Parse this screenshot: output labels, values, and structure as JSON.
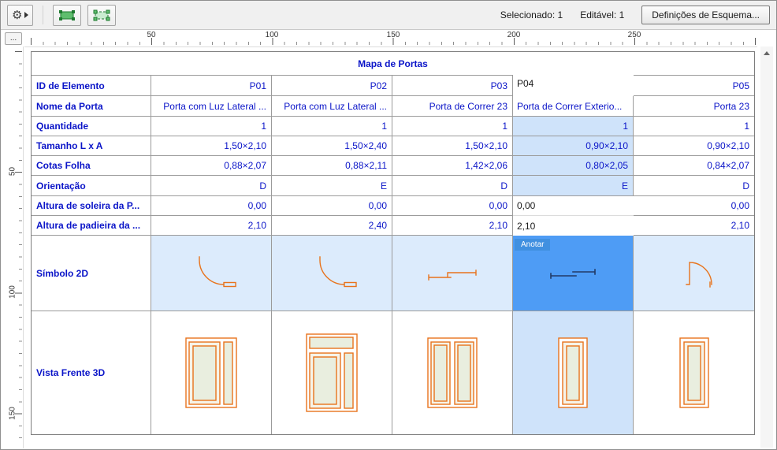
{
  "toolbar": {
    "status_selected": "Selecionado: 1",
    "status_editable": "Editável: 1",
    "scheme_button_label": "Definições de Esquema...",
    "icons": {
      "settings": "gear-with-dropdown-arrow",
      "button_1": "green-selection-rectangle",
      "button_2": "green-selection-rectangle-outline"
    }
  },
  "rulers": {
    "corner_button_label": "...",
    "horizontal_labels": [
      "50",
      "100",
      "150",
      "200",
      "250"
    ],
    "vertical_labels": [
      "50",
      "100",
      "150"
    ]
  },
  "schedule": {
    "title": "Mapa de Portas",
    "row_labels": [
      "ID de Elemento",
      "Nome da Porta",
      "Quantidade",
      "Tamanho L x A",
      "Cotas Folha",
      "Orientação",
      "Altura de soleira da P...",
      "Altura de padieira da ...",
      "Símbolo 2D",
      "Vista Frente 3D"
    ],
    "annotate_button_label": "Anotar",
    "doors": [
      {
        "id": "P01",
        "nome": "Porta com Luz Lateral ...",
        "quantidade": "1",
        "tamanho": "1,50×2,10",
        "cotas_folha": "0,88×2,07",
        "orientacao": "D",
        "altura_soleira": "0,00",
        "altura_padieira": "2,10",
        "simbolo_2d": "swing-door",
        "vista_3d": "door-with-sidelight"
      },
      {
        "id": "P02",
        "nome": "Porta com Luz Lateral ...",
        "quantidade": "1",
        "tamanho": "1,50×2,40",
        "cotas_folha": "0,88×2,11",
        "orientacao": "E",
        "altura_soleira": "0,00",
        "altura_padieira": "2,40",
        "simbolo_2d": "swing-door",
        "vista_3d": "door-with-sidelight-and-transom"
      },
      {
        "id": "P03",
        "nome": "Porta de Correr 23",
        "quantidade": "1",
        "tamanho": "1,50×2,10",
        "cotas_folha": "1,42×2,06",
        "orientacao": "D",
        "altura_soleira": "0,00",
        "altura_padieira": "2,10",
        "simbolo_2d": "sliding-door",
        "vista_3d": "double-sliding-door"
      },
      {
        "id": "P04",
        "nome": "Porta de Correr Exterio...",
        "quantidade": "1",
        "tamanho": "0,90×2,10",
        "cotas_folha": "0,80×2,05",
        "orientacao": "E",
        "altura_soleira": "0,00",
        "altura_padieira": "2,10",
        "simbolo_2d": "sliding-door",
        "vista_3d": "single-door",
        "selected": true
      },
      {
        "id": "P05",
        "nome": "Porta 23",
        "quantidade": "1",
        "tamanho": "0,90×2,10",
        "cotas_folha": "0,84×2,07",
        "orientacao": "D",
        "altura_soleira": "0,00",
        "altura_padieira": "2,10",
        "simbolo_2d": "swing-door",
        "vista_3d": "single-door"
      }
    ]
  },
  "colors": {
    "text_blue": "#0a14c8",
    "selection_light": "#cfe3fa",
    "selection_strong": "#4e9cf5",
    "symbol_row_bg": "#dcebfc",
    "symbol_orange": "#e8731c",
    "annotate_bg": "#4090e0"
  }
}
